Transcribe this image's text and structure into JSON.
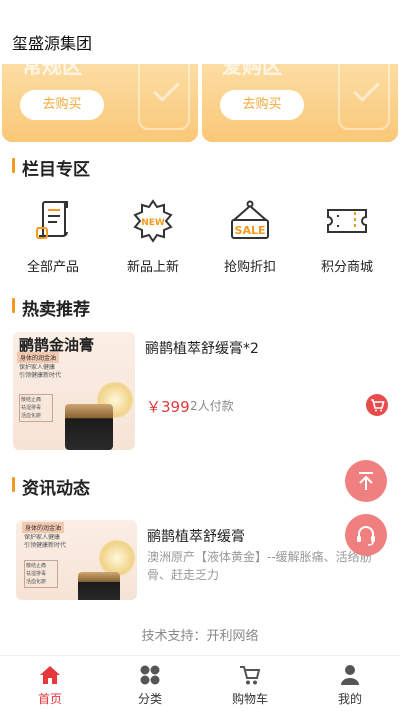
{
  "header": {
    "title": "玺盛源集团"
  },
  "banners": [
    {
      "title": "常规区",
      "button": "去购买"
    },
    {
      "title": "爱购区",
      "button": "去购买"
    }
  ],
  "section_column": {
    "title": "栏目专区"
  },
  "categories": [
    {
      "label": "全部产品",
      "icon": "document-list-icon"
    },
    {
      "label": "新品上新",
      "icon": "new-badge-icon"
    },
    {
      "label": "抢购折扣",
      "icon": "sale-sign-icon"
    },
    {
      "label": "积分商城",
      "icon": "ticket-icon"
    }
  ],
  "section_hot": {
    "title": "热卖推荐"
  },
  "product": {
    "image_title": "鹂鹊金油膏",
    "image_sub": "身体的润金油",
    "image_line1": "保护家人健康",
    "image_line2": "引领健康新时代",
    "image_tag1": "散结止痛",
    "image_tag2": "祛湿排毒",
    "image_tag3": "活血化瘀",
    "name": "鹂鹊植萃舒缓膏*2",
    "price": "￥399",
    "sold": "2人付款"
  },
  "section_news": {
    "title": "资讯动态"
  },
  "news": {
    "image_sub": "身体的润金油",
    "image_line1": "保护家人健康",
    "image_line2": "引领健康新时代",
    "image_tag1": "散结止痛",
    "image_tag2": "祛湿排毒",
    "image_tag3": "活血化瘀",
    "title": "鹂鹊植萃舒缓膏",
    "desc": "澳洲原产【液体黄金】--缓解胀痛、活络筋骨、赶走乏力"
  },
  "footer": {
    "support": "技术支持：开利网络"
  },
  "tabbar": [
    {
      "label": "首页",
      "icon": "home-icon",
      "active": true
    },
    {
      "label": "分类",
      "icon": "grid-icon",
      "active": false
    },
    {
      "label": "购物车",
      "icon": "cart-icon",
      "active": false
    },
    {
      "label": "我的",
      "icon": "user-icon",
      "active": false
    }
  ],
  "colors": {
    "accent": "#f39a1e",
    "price": "#e4393c",
    "banner": "#f9c877",
    "float": "#f08080"
  }
}
